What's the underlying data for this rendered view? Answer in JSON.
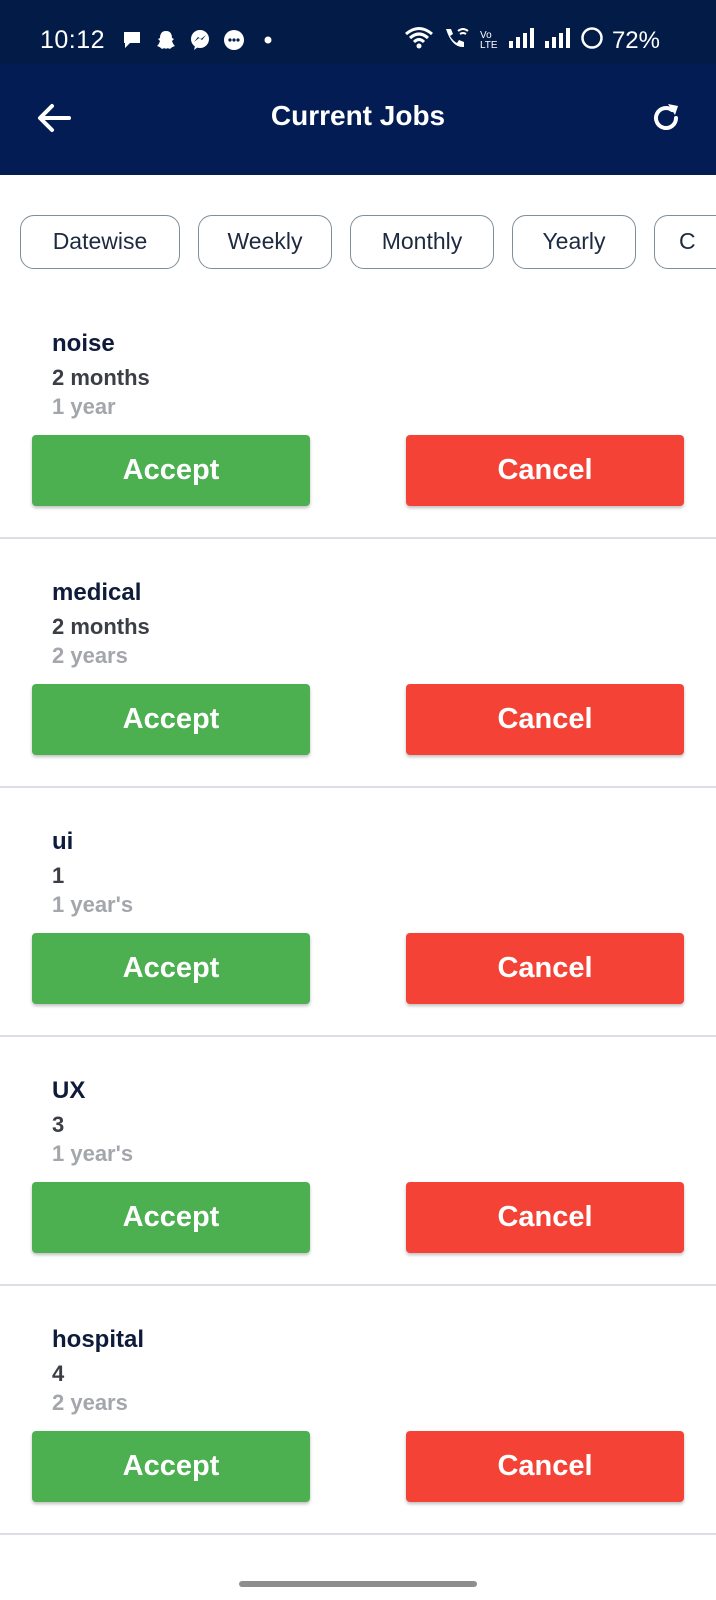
{
  "status_bar": {
    "time": "10:12",
    "battery": "72%",
    "notification_icons": [
      "chat-bubble-icon",
      "snapchat-ghost-icon",
      "messenger-icon",
      "message-dots-icon",
      "dot-icon"
    ],
    "system_icons": [
      "wifi-icon",
      "wifi-calling-icon",
      "volte-icon",
      "signal-icon",
      "signal-icon",
      "battery-saver-icon"
    ],
    "volte_label": "Vo LTE"
  },
  "app_bar": {
    "title": "Current Jobs",
    "back_icon": "arrow-left-icon",
    "refresh_icon": "refresh-icon"
  },
  "filters": [
    "Datewise",
    "Weekly",
    "Monthly",
    "Yearly",
    "C"
  ],
  "jobs": [
    {
      "title": "noise",
      "duration": "2 months",
      "experience": "1 year",
      "accept_label": "Accept",
      "cancel_label": "Cancel"
    },
    {
      "title": "medical",
      "duration": "2 months",
      "experience": "2 years",
      "accept_label": "Accept",
      "cancel_label": "Cancel"
    },
    {
      "title": "ui",
      "duration": "1",
      "experience": "1 year's",
      "accept_label": "Accept",
      "cancel_label": "Cancel"
    },
    {
      "title": "UX",
      "duration": "3",
      "experience": "1 year's",
      "accept_label": "Accept",
      "cancel_label": "Cancel"
    },
    {
      "title": "hospital",
      "duration": "4",
      "experience": "2 years",
      "accept_label": "Accept",
      "cancel_label": "Cancel"
    }
  ],
  "colors": {
    "status_bar_bg": "#031b47",
    "app_bar_bg": "#031d54",
    "accept": "#4caf50",
    "cancel": "#f44336",
    "title_text": "#0f1b3a",
    "duration_text": "#3b3f45",
    "experience_text": "#a3a6ab"
  }
}
